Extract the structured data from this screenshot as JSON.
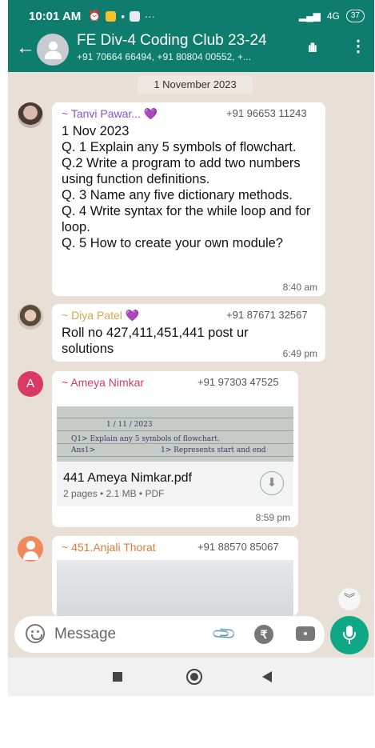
{
  "status_bar": {
    "time": "10:01 AM",
    "network": "4G",
    "battery": "37"
  },
  "header": {
    "title": "FE Div-4 Coding Club 23-24",
    "subtitle": "+91 70664 66494, +91 80804 00552, +..."
  },
  "chat": {
    "date_chip": "1 November 2023",
    "messages": [
      {
        "sender": "~ Tanvi Pawar... 💜",
        "sender_color": "#8a52c9",
        "phone": "+91 96653 11243",
        "text": "1 Nov 2023\nQ. 1 Explain any 5 symbols of flowchart.\nQ.2 Write a program to add two numbers using function definitions.\nQ. 3 Name any five dictionary methods.\nQ. 4 Write syntax for the while loop and for loop.\nQ. 5 How to create your own module?",
        "time": "8:40 am"
      },
      {
        "sender": "~ Diya Patel 💜",
        "sender_color": "#d4a94a",
        "phone": "+91 87671 32567",
        "text": "Roll no 427,411,451,441 post ur solutions",
        "time": "6:49 pm"
      },
      {
        "sender": "~ Ameya Nimkar",
        "sender_color": "#d63b66",
        "avatar_letter": "A",
        "phone": "+91 97303 47525",
        "document": {
          "name": "441 Ameya Nimkar.pdf",
          "meta": "2 pages • 2.1 MB • PDF",
          "preview_date": "1 / 11 / 2023",
          "preview_line1": "Q1> Explain any 5 symbols of flowchart.",
          "preview_line2": "Ans1>",
          "preview_line3": "1> Represents start and end"
        },
        "time": "8:59 pm"
      },
      {
        "sender": "~ 451.Anjali Thorat",
        "sender_color": "#e0793c",
        "phone": "+91 88570 85067"
      }
    ]
  },
  "composer": {
    "placeholder": "Message"
  },
  "colors": {
    "header": "#0f7d6e",
    "chat_bg": "#e8dfd6",
    "accent": "#0fa887"
  },
  "icons": [
    "back-arrow-icon",
    "group-avatar-icon",
    "audio-call-icon",
    "more-vert-icon",
    "emoji-icon",
    "attach-icon",
    "rupee-icon",
    "camera-icon",
    "mic-icon",
    "download-icon",
    "scroll-down-icon"
  ]
}
